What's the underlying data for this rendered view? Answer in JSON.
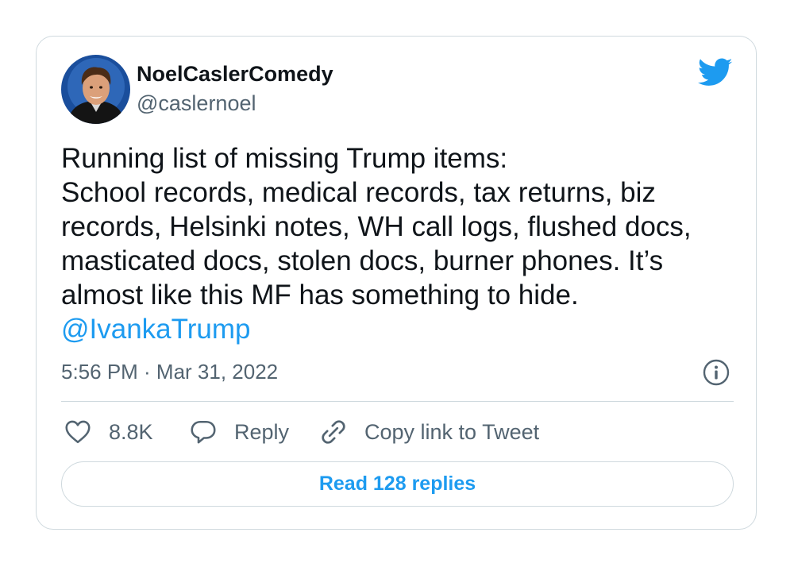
{
  "author": {
    "display_name": "NoelCaslerComedy",
    "handle": "@caslernoel",
    "avatar_icon": "profile-photo"
  },
  "logo_icon": "twitter-bird-icon",
  "brand_color": "#1d9bf0",
  "tweet": {
    "lines": [
      "Running list of missing Trump items:",
      "School records, medical records, tax returns, biz",
      "records, Helsinki notes, WH call logs, flushed docs,",
      "masticated docs, stolen docs, burner phones. It’s",
      "almost like this MF has something to hide."
    ],
    "mention": "@IvankaTrump",
    "timestamp": "5:56 PM · Mar 31, 2022"
  },
  "info_icon": "info-icon",
  "actions": {
    "like": {
      "icon": "heart-icon",
      "label": "8.8K"
    },
    "reply": {
      "icon": "speech-bubble-icon",
      "label": "Reply"
    },
    "copy": {
      "icon": "link-icon",
      "label": "Copy link to Tweet"
    }
  },
  "replies_button": {
    "label": "Read 128 replies"
  }
}
